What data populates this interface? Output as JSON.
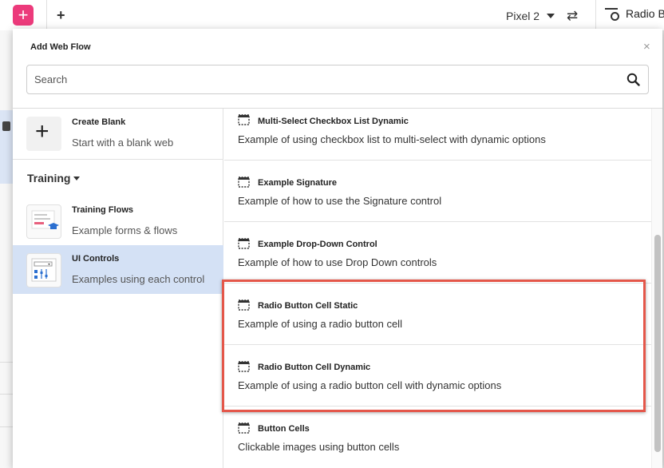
{
  "app": {
    "add_label": "+",
    "new_tab_label": "+",
    "device": "Pixel 2",
    "rotate_glyph": "⇄",
    "properties_label": "Radio B"
  },
  "modal": {
    "title": "Add Web Flow",
    "close_glyph": "×",
    "search": {
      "placeholder": "Search",
      "value": ""
    }
  },
  "sidebar": {
    "create_blank": {
      "title": "Create Blank",
      "subtitle": "Start with a blank web",
      "glyph": "+"
    },
    "section_label": "Training",
    "items": [
      {
        "title": "Training Flows",
        "subtitle": "Example forms & flows",
        "icon": "training-flows-icon"
      },
      {
        "title": "UI Controls",
        "subtitle": "Examples using each control",
        "icon": "ui-controls-icon"
      }
    ]
  },
  "flows": [
    {
      "title": "Multi-Select Checkbox List Dynamic",
      "description": "Example of using checkbox list to multi-select with dynamic options"
    },
    {
      "title": "Example Signature",
      "description": "Example of how to use the Signature control"
    },
    {
      "title": "Example Drop-Down Control",
      "description": "Example of how to use Drop Down controls"
    },
    {
      "title": "Radio Button Cell Static",
      "description": "Example of using a radio button cell"
    },
    {
      "title": "Radio Button Cell Dynamic",
      "description": "Example of using a radio button cell with dynamic options"
    },
    {
      "title": "Button Cells",
      "description": "Clickable images using button cells"
    }
  ],
  "colors": {
    "brand_pink": "#ec3a7b",
    "selection_blue": "#d4e1f5",
    "highlight_red": "#e4574a"
  }
}
